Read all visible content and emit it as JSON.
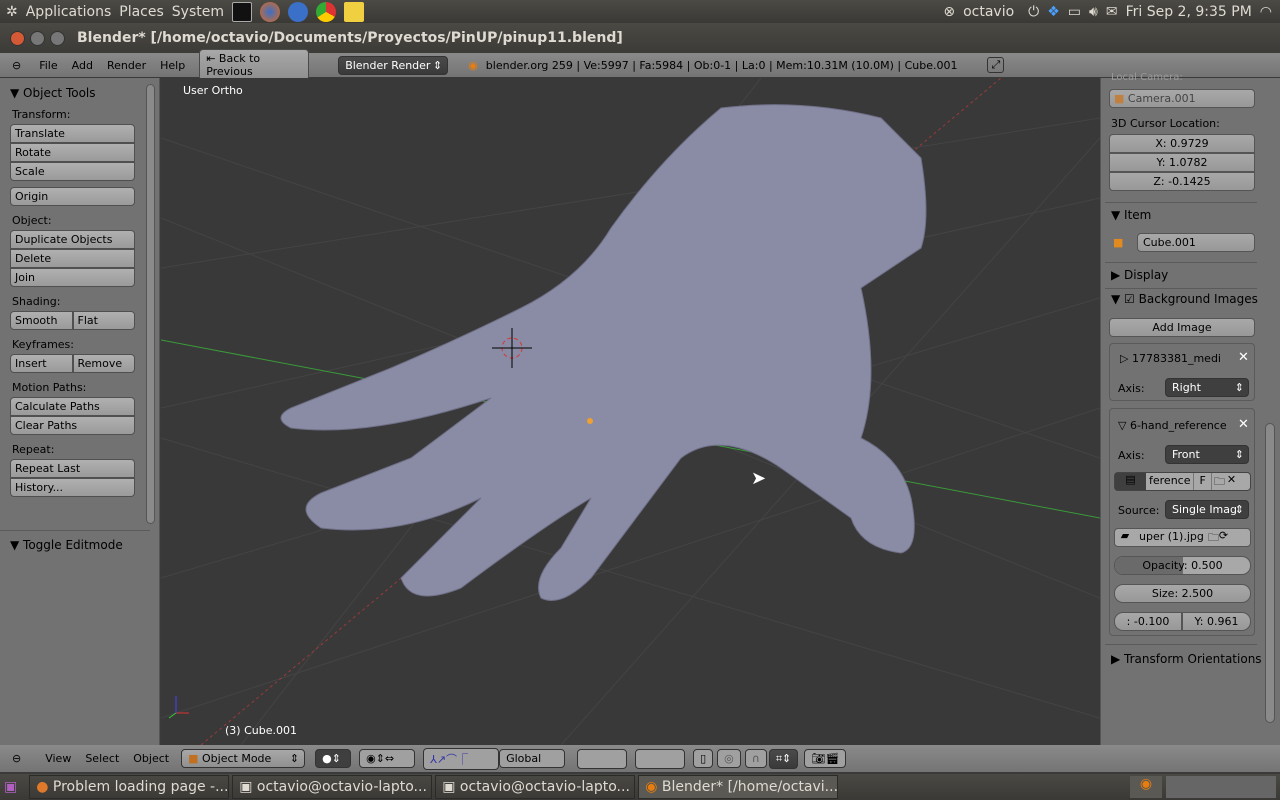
{
  "top_panel": {
    "menus": [
      "Applications",
      "Places",
      "System"
    ],
    "user": "octavio",
    "clock": "Fri Sep  2,  9:35 PM"
  },
  "window": {
    "title": "Blender* [/home/octavio/Documents/Proyectos/PinUP/pinup11.blend]"
  },
  "header": {
    "menus": [
      "File",
      "Add",
      "Render",
      "Help"
    ],
    "back_button": "Back to Previous",
    "render_engine": "Blender Render",
    "stats": "blender.org 259 | Ve:5997 | Fa:5984 | Ob:0-1 | La:0 | Mem:10.31M (10.0M) | Cube.001"
  },
  "toolshelf": {
    "title": "Object Tools",
    "transform_label": "Transform:",
    "translate": "Translate",
    "rotate": "Rotate",
    "scale": "Scale",
    "origin": "Origin",
    "object_label": "Object:",
    "duplicate": "Duplicate Objects",
    "delete": "Delete",
    "join": "Join",
    "shading_label": "Shading:",
    "smooth": "Smooth",
    "flat": "Flat",
    "keyframes_label": "Keyframes:",
    "insert": "Insert",
    "remove": "Remove",
    "motion_label": "Motion Paths:",
    "calc_paths": "Calculate Paths",
    "clear_paths": "Clear Paths",
    "repeat_label": "Repeat:",
    "repeat_last": "Repeat Last",
    "history": "History...",
    "toggle_editmode": "Toggle Editmode"
  },
  "viewport": {
    "view_label": "User Ortho",
    "object_label": "(3) Cube.001"
  },
  "properties": {
    "local_camera_label": "Local Camera:",
    "camera": "Camera.001",
    "cursor_label": "3D Cursor Location:",
    "cursor_x": "X: 0.9729",
    "cursor_y": "Y: 1.0782",
    "cursor_z": "Z: -0.1425",
    "item_title": "Item",
    "item_name": "Cube.001",
    "display_title": "Display",
    "bg_title": "Background Images",
    "bg_enabled": true,
    "add_image": "Add Image",
    "img1_name": "17783381_medi",
    "axis_label": "Axis:",
    "img1_axis": "Right",
    "img2_name": "6-hand_reference",
    "img2_axis": "Front",
    "img2_image": "ference",
    "img2_f": "F",
    "source_label": "Source:",
    "source": "Single Imag",
    "file": "uper (1).jpg",
    "opacity": "Opacity: 0.500",
    "opacity_value": 0.5,
    "size": "Size: 2.500",
    "offset_x": ": -0.100",
    "offset_y": "Y: 0.961",
    "transform_orient": "Transform Orientations"
  },
  "bottom_header": {
    "menus": [
      "View",
      "Select",
      "Object"
    ],
    "mode": "Object Mode",
    "orientation": "Global"
  },
  "taskbar": {
    "items": [
      "Problem loading page -...",
      "octavio@octavio-lapto...",
      "octavio@octavio-lapto...",
      "Blender* [/home/octavi..."
    ]
  },
  "colors": {
    "viewport_bg": "#393939",
    "panel_bg": "#727272",
    "mesh": "#8a8ba0",
    "x_axis": "#c03030",
    "y_axis": "#30a030"
  }
}
